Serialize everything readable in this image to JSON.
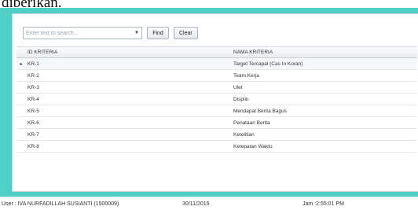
{
  "document": {
    "fragment_text": "diberikan."
  },
  "search": {
    "placeholder": "Enter text to search...",
    "find_label": "Find",
    "clear_label": "Clear",
    "dropdown_icon": "chevron-down-icon"
  },
  "grid": {
    "columns": [
      "ID KRITERIA",
      "NAMA KRITERIA"
    ],
    "rows": [
      {
        "id": "KR-1",
        "name": "Target Tercapai (Cas In Koran)"
      },
      {
        "id": "KR-2",
        "name": "Team Kerja"
      },
      {
        "id": "KR-3",
        "name": "Ulet"
      },
      {
        "id": "KR-4",
        "name": "Displin"
      },
      {
        "id": "KR-5",
        "name": "Mendapat Berita Bagus"
      },
      {
        "id": "KR-6",
        "name": "Penataan Berita"
      },
      {
        "id": "KR-7",
        "name": "Ketelitian"
      },
      {
        "id": "KR-8",
        "name": "Ketepatan Waktu"
      }
    ],
    "selected_row_indicator": "▸"
  },
  "status_bar": {
    "user": "User : IVA NURFADILLAH SUSIANTI (1500009)",
    "date": "30/11/2015",
    "time": "Jam :2:55:01 PM"
  },
  "colors": {
    "frame": "#4fcfc6",
    "panel": "#ffffff",
    "header_bg": "#eef1f3"
  }
}
